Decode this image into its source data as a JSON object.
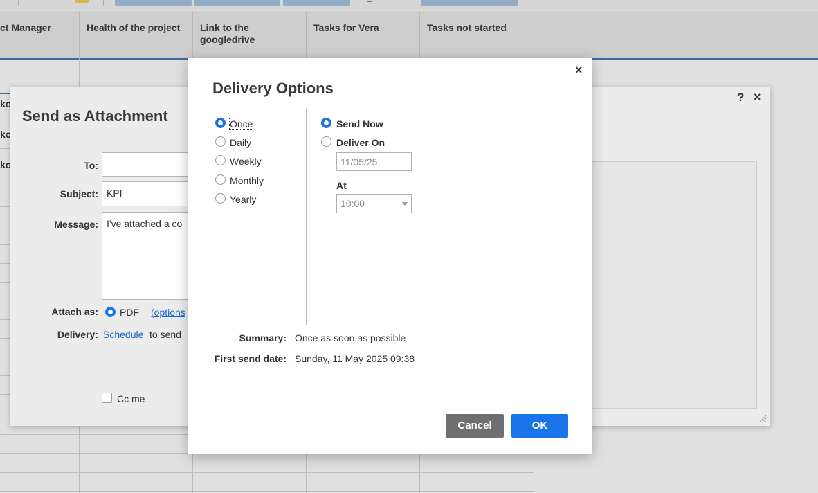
{
  "sheet": {
    "columns": [
      {
        "label": "ct Manager"
      },
      {
        "label": "Health of the project"
      },
      {
        "label": "Link to the googledrive"
      },
      {
        "label": "Tasks for Vera"
      },
      {
        "label": "Tasks not started"
      }
    ],
    "row_fragments": [
      "ko",
      "ko",
      "ko"
    ]
  },
  "send_dialog": {
    "title": "Send as Attachment",
    "help_icon": "?",
    "close_icon": "×",
    "to_label": "To:",
    "to_value": "",
    "subject_label": "Subject:",
    "subject_value": "KPI",
    "message_label": "Message:",
    "message_value": "I've attached a co",
    "attach_label": "Attach as:",
    "attach_option": "PDF",
    "options_link": "(options",
    "delivery_label": "Delivery:",
    "schedule_link": "Schedule",
    "delivery_text": "to send",
    "cc_label": "Cc me"
  },
  "delivery_dialog": {
    "title": "Delivery Options",
    "close_icon": "×",
    "frequency": [
      {
        "label": "Once",
        "selected": true
      },
      {
        "label": "Daily",
        "selected": false
      },
      {
        "label": "Weekly",
        "selected": false
      },
      {
        "label": "Monthly",
        "selected": false
      },
      {
        "label": "Yearly",
        "selected": false
      }
    ],
    "send_now_label": "Send Now",
    "deliver_on_label": "Deliver On",
    "date_value": "11/05/25",
    "at_label": "At",
    "time_value": "10:00",
    "summary_label": "Summary:",
    "summary_value": "Once as soon as possible",
    "first_send_label": "First send date:",
    "first_send_value": "Sunday, 11 May 2025 09:38",
    "cancel_label": "Cancel",
    "ok_label": "OK"
  },
  "colors": {
    "accent": "#1a73e8",
    "cancel_button": "#6f6f6f",
    "link": "#1767c7",
    "header_rule": "#4a78b5"
  }
}
